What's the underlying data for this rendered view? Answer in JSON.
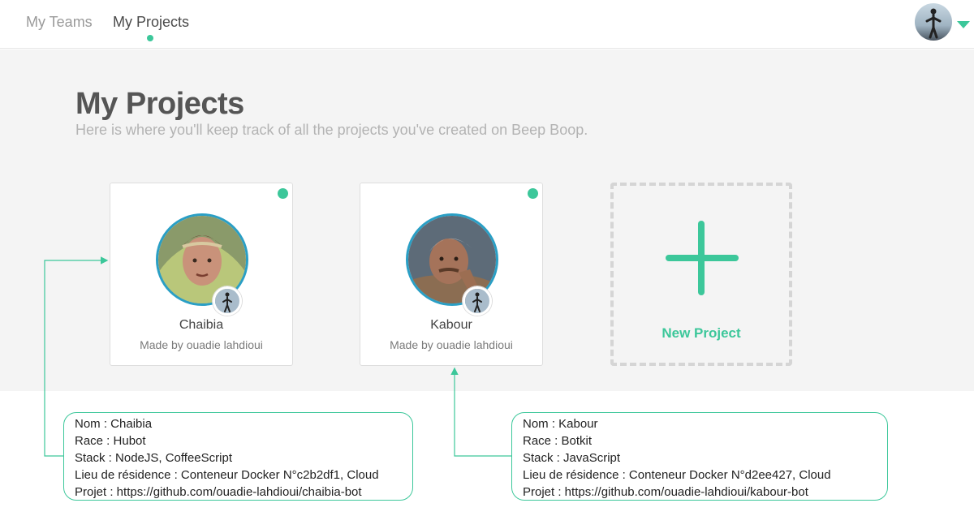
{
  "nav": {
    "tabs": [
      {
        "label": "My Teams",
        "active": false
      },
      {
        "label": "My Projects",
        "active": true
      }
    ]
  },
  "header": {
    "title": "My Projects",
    "subtitle": "Here is where you'll keep track of all the projects you've created on Beep Boop."
  },
  "projects": [
    {
      "name": "Chaibia",
      "made_by": "Made by ouadie lahdioui",
      "status": "online"
    },
    {
      "name": "Kabour",
      "made_by": "Made by ouadie lahdioui",
      "status": "online"
    }
  ],
  "new_project": {
    "label": "New Project"
  },
  "info_boxes": [
    {
      "lines": [
        "Nom : Chaibia",
        "Race : Hubot",
        "Stack : NodeJS, CoffeeScript",
        "Lieu de résidence : Conteneur Docker N°c2b2df1, Cloud",
        "Projet : https://github.com/ouadie-lahdioui/chaibia-bot"
      ]
    },
    {
      "lines": [
        "Nom : Kabour",
        "Race : Botkit",
        "Stack : JavaScript",
        "Lieu de résidence : Conteneur Docker N°d2ee427, Cloud",
        "Projet : https://github.com/ouadie-lahdioui/kabour-bot"
      ]
    }
  ],
  "colors": {
    "accent": "#3cc79a",
    "avatar_ring": "#2a9fc5",
    "band": "#f4f4f4"
  },
  "icons": [
    "user-avatar-icon",
    "dropdown-caret-icon",
    "status-dot-icon",
    "plus-icon",
    "owner-avatar-icon"
  ]
}
